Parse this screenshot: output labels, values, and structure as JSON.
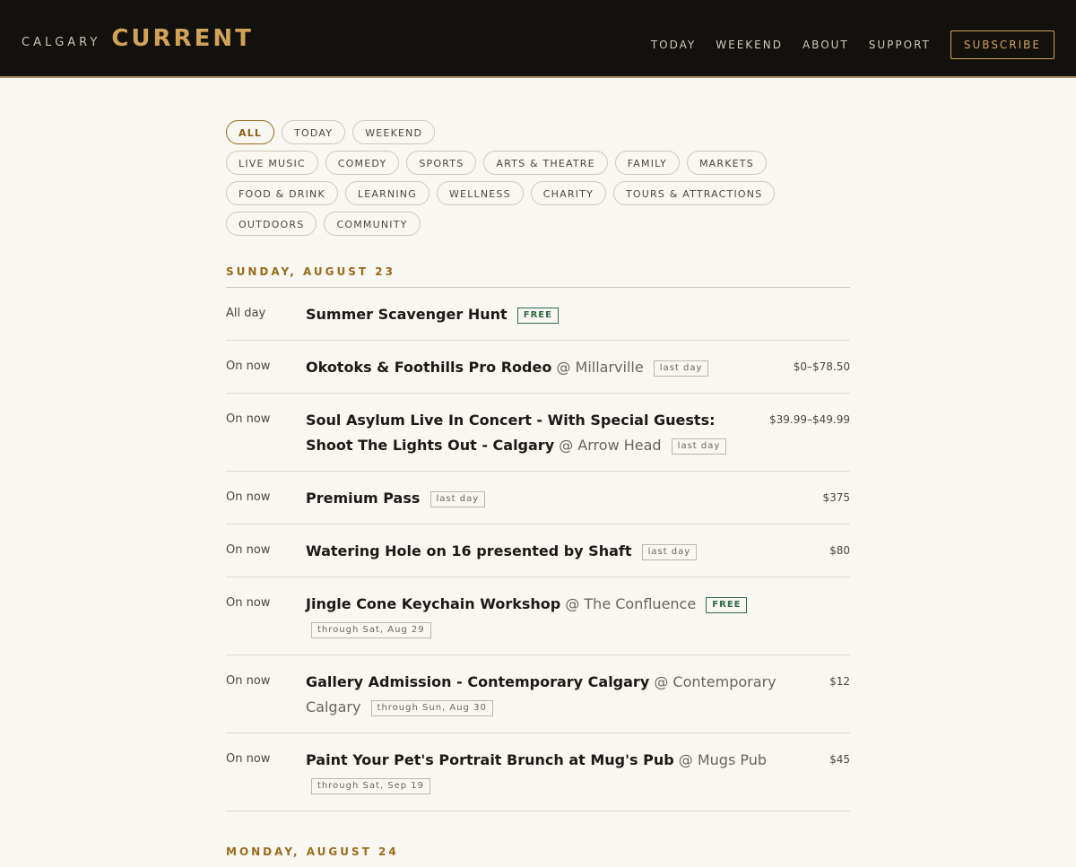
{
  "header": {
    "city": "CALGARY",
    "name": "CURRENT",
    "nav": [
      "TODAY",
      "WEEKEND",
      "ABOUT",
      "SUPPORT"
    ],
    "subscribe": "SUBSCRIBE"
  },
  "filters": {
    "row1": [
      "ALL",
      "TODAY",
      "WEEKEND"
    ],
    "row2": [
      "LIVE MUSIC",
      "COMEDY",
      "SPORTS",
      "ARTS & THEATRE",
      "FAMILY",
      "MARKETS"
    ],
    "row3": [
      "FOOD & DRINK",
      "LEARNING",
      "WELLNESS",
      "CHARITY",
      "TOURS & ATTRACTIONS"
    ],
    "row4": [
      "OUTDOORS",
      "COMMUNITY"
    ]
  },
  "days": [
    {
      "heading": "SUNDAY, AUGUST 23",
      "events": [
        {
          "time": "All day",
          "title": "Summer Scavenger Hunt",
          "venue": "",
          "tags": [
            {
              "text": "FREE",
              "free": true
            }
          ],
          "price": ""
        },
        {
          "time": "On now",
          "title": "Okotoks & Foothills Pro Rodeo",
          "venue": "@ Millarville",
          "tags": [
            {
              "text": "last day",
              "free": false
            }
          ],
          "price": "$0–$78.50"
        },
        {
          "time": "On now",
          "title": "Soul Asylum Live In Concert - With Special Guests: Shoot The Lights Out - Calgary",
          "venue": "@ Arrow Head",
          "tags": [
            {
              "text": "last day",
              "free": false
            }
          ],
          "price": "$39.99–$49.99"
        },
        {
          "time": "On now",
          "title": "Premium Pass",
          "venue": "",
          "tags": [
            {
              "text": "last day",
              "free": false
            }
          ],
          "price": "$375"
        },
        {
          "time": "On now",
          "title": "Watering Hole on 16 presented by Shaft",
          "venue": "",
          "tags": [
            {
              "text": "last day",
              "free": false
            }
          ],
          "price": "$80"
        },
        {
          "time": "On now",
          "title": "Jingle Cone Keychain Workshop",
          "venue": "@ The Confluence",
          "tags": [
            {
              "text": "FREE",
              "free": true
            },
            {
              "text": "through Sat, Aug 29",
              "free": false
            }
          ],
          "price": ""
        },
        {
          "time": "On now",
          "title": "Gallery Admission - Contemporary Calgary",
          "venue": "@ Contemporary Calgary",
          "tags": [
            {
              "text": "through Sun, Aug 30",
              "free": false
            }
          ],
          "price": "$12"
        },
        {
          "time": "On now",
          "title": "Paint Your Pet's Portrait Brunch at Mug's Pub",
          "venue": "@ Mugs Pub",
          "tags": [
            {
              "text": "through Sat, Sep 19",
              "free": false
            }
          ],
          "price": "$45"
        }
      ]
    },
    {
      "heading": "MONDAY, AUGUST 24",
      "events": []
    }
  ]
}
